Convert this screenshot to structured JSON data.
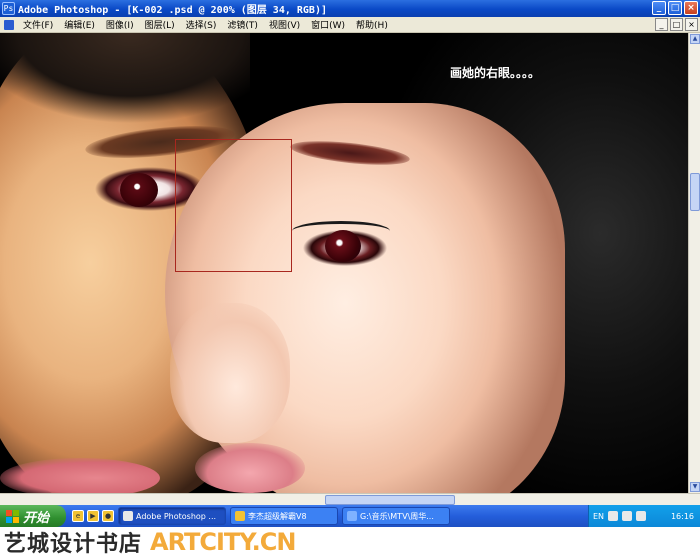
{
  "window": {
    "title": "Adobe Photoshop - [K-002 .psd @ 200% (图层 34, RGB)]",
    "min_label": "_",
    "max_label": "□",
    "close_label": "×"
  },
  "menu": {
    "items": [
      "文件(F)",
      "编辑(E)",
      "图像(I)",
      "图层(L)",
      "选择(S)",
      "滤镜(T)",
      "视图(V)",
      "窗口(W)",
      "帮助(H)"
    ],
    "doc_controls": [
      "_",
      "□",
      "×"
    ]
  },
  "canvas": {
    "annotation": "画她的右眼。。。。",
    "selection_color": "#a8271e"
  },
  "taskbar": {
    "start_label": "开始",
    "tasks": [
      {
        "label": "Adobe Photoshop ...",
        "active": true
      },
      {
        "label": "李杰超级解霸V8",
        "active": false
      },
      {
        "label": "G:\\音乐\\MTV\\周华...",
        "active": false
      }
    ],
    "language": "EN",
    "clock": "16:16"
  },
  "watermark": {
    "cn_text": "艺城设计书店",
    "en_text": "ARTCITY.CN"
  }
}
